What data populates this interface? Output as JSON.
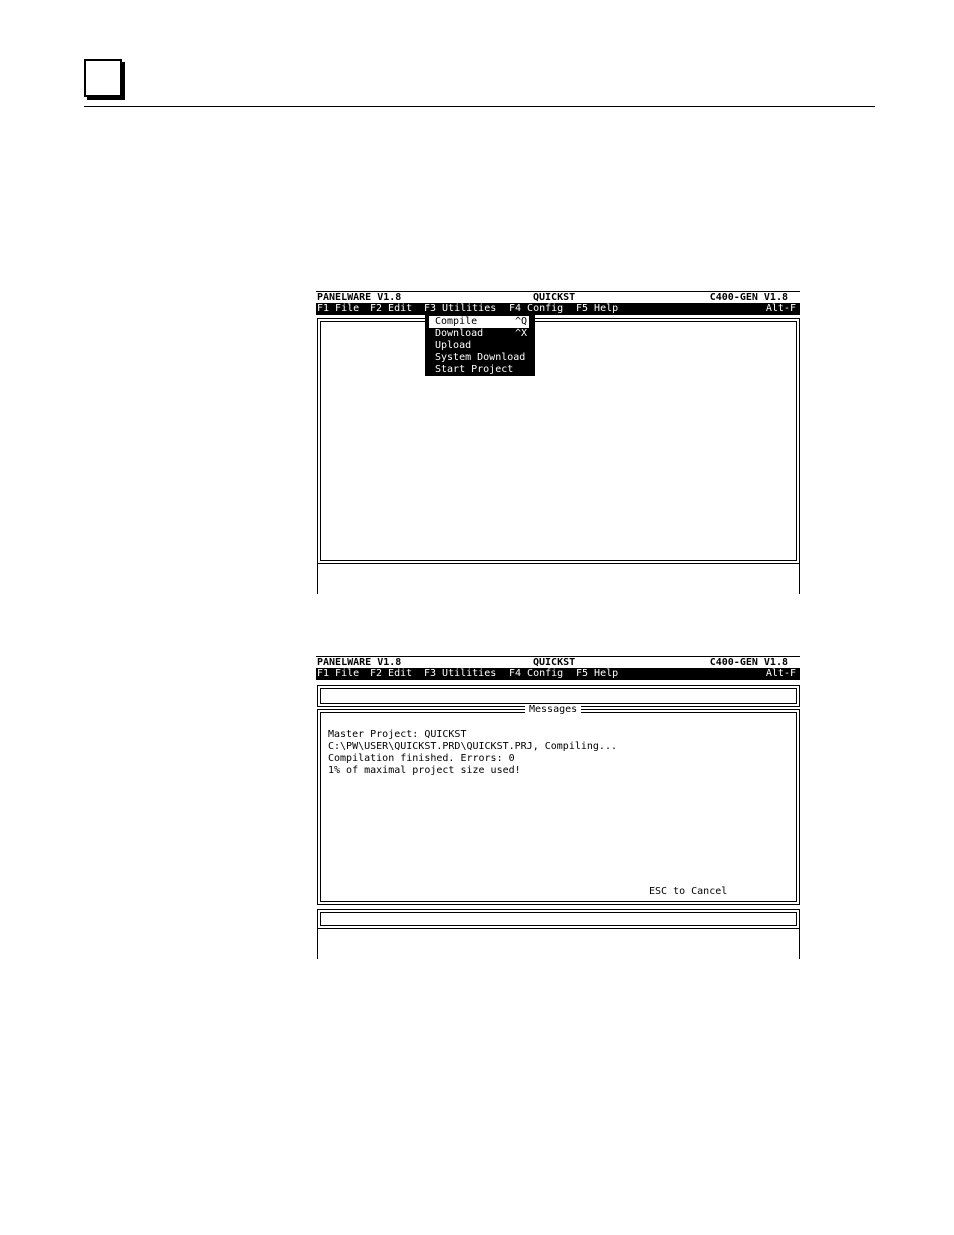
{
  "header": {
    "chapter_box": ""
  },
  "screen1": {
    "title_left": "PANELWARE V1.8",
    "title_center": "QUICKST",
    "title_right": "C400-GEN V1.8",
    "menu": {
      "file": "F1 File",
      "edit": "F2 Edit",
      "utilities": "F3 Utilities",
      "config": "F4 Config",
      "help": "F5 Help",
      "alt": "Alt-F"
    },
    "dropdown": [
      {
        "label": "Compile",
        "key": "^Q",
        "selected": true
      },
      {
        "label": "Download",
        "key": "^X",
        "selected": false
      },
      {
        "label": "Upload",
        "key": "",
        "selected": false
      },
      {
        "label": "System Download",
        "key": "",
        "selected": false
      },
      {
        "label": "Start Project",
        "key": "",
        "selected": false
      }
    ]
  },
  "screen2": {
    "title_left": "PANELWARE V1.8",
    "title_center": "QUICKST",
    "title_right": "C400-GEN V1.8",
    "menu": {
      "file": "F1 File",
      "edit": "F2 Edit",
      "utilities": "F3 Utilities",
      "config": "F4 Config",
      "help": "F5 Help",
      "alt": "Alt-F"
    },
    "messages_title": "Messages",
    "messages": [
      "Master Project: QUICKST",
      "C:\\PW\\USER\\QUICKST.PRD\\QUICKST.PRJ, Compiling...",
      "Compilation finished. Errors: 0",
      "1% of maximal project size used!"
    ],
    "cancel_hint": "ESC to Cancel"
  }
}
